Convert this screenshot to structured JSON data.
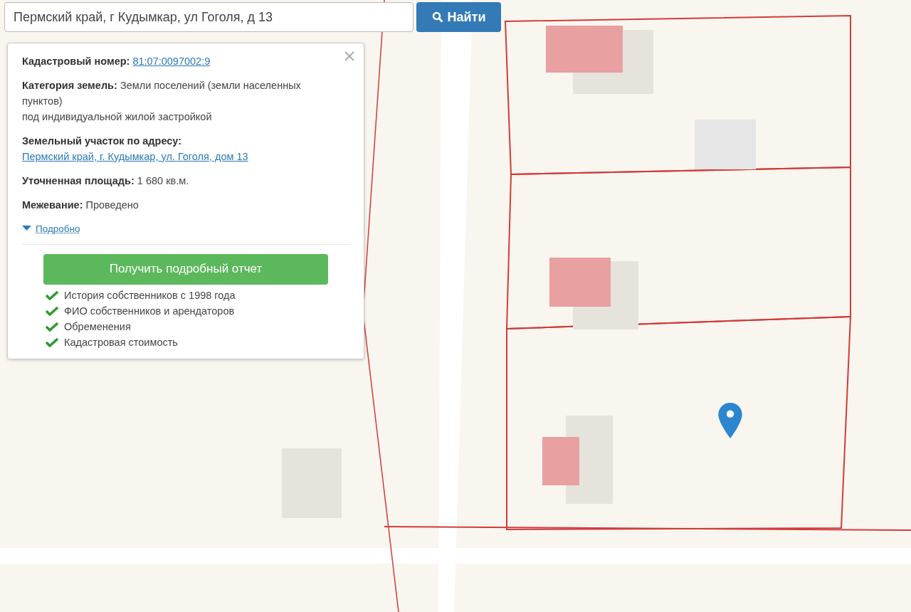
{
  "search": {
    "value": "Пермский край, г Кудымкар, ул Гоголя, д 13",
    "button": "Найти"
  },
  "popup": {
    "fields": [
      {
        "kind": "link",
        "label": "Кадастровый номер:",
        "value": "81:07:0097002:9"
      },
      {
        "kind": "text",
        "label": "Категория земель:",
        "value": "Земли поселений (земли населенных пунктов)",
        "note": "под индивидуальной жилой застройкой"
      },
      {
        "kind": "link",
        "label": "Земельный участок по адресу:",
        "value": "Пермский край, г. Кудымкар, ул. Гоголя, дом 13"
      },
      {
        "kind": "text",
        "label": "Уточненная площадь:",
        "value": "1 680 кв.м."
      },
      {
        "kind": "text",
        "label": "Межевание:",
        "value": "Проведено"
      }
    ],
    "more_link": "Подробно",
    "report_button": "Получить подробный отчет",
    "features": [
      "История собственников с 1998 года",
      "ФИО собственников и арендаторов",
      "Обременения",
      "Кадастровая стоимость"
    ]
  }
}
